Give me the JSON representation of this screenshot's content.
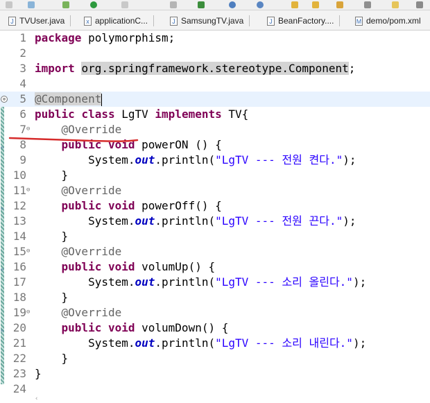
{
  "tabs": [
    {
      "label": "TVUser.java",
      "icon": "java-file-icon"
    },
    {
      "label": "applicationC...",
      "icon": "xml-file-icon"
    },
    {
      "label": "SamsungTV.java",
      "icon": "java-file-icon"
    },
    {
      "label": "BeanFactory....",
      "icon": "java-file-icon"
    },
    {
      "label": "demo/pom.xml",
      "icon": "maven-file-icon"
    }
  ],
  "line_numbers": [
    "1",
    "2",
    "3",
    "4",
    "5",
    "6",
    "7",
    "8",
    "9",
    "10",
    "11",
    "12",
    "13",
    "14",
    "15",
    "16",
    "17",
    "18",
    "19",
    "20",
    "21",
    "22",
    "23",
    "24"
  ],
  "code": {
    "l1_kw": "package",
    "l1_rest": " polymorphism;",
    "l3_kw": "import",
    "l3_pkg": "org.springframework.stereotype.Component",
    "l3_end": ";",
    "l5_ann": "@Component",
    "l6_kw1": "public",
    "l6_kw2": "class",
    "l6_name": " LgTV ",
    "l6_kw3": "implements",
    "l6_rest": " TV{",
    "override": "@Override",
    "public": "public",
    "void": "void",
    "m1": " powerON () {",
    "m2": " powerOff() {",
    "m3": " volumUp() {",
    "m4": " volumDown() {",
    "sys": "System.",
    "out": "out",
    "println": ".println(",
    "s1": "\"LgTV --- 전원 켠다.\"",
    "s2": "\"LgTV --- 전원 끈다.\"",
    "s3": "\"LgTV --- 소리 올린다.\"",
    "s4": "\"LgTV --- 소리 내린다.\"",
    "call_end": ");",
    "close": "}"
  },
  "colors": {
    "keyword": "#7f0055",
    "annotation": "#646464",
    "string": "#2a00ff",
    "static_field": "#0000c0",
    "underline": "#d62b2b"
  }
}
